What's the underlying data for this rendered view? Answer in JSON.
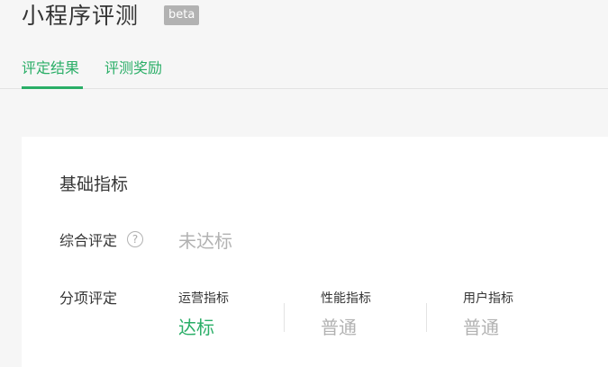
{
  "header": {
    "title": "小程序评测",
    "badge": "beta",
    "tabs": [
      {
        "label": "评定结果",
        "active": true
      },
      {
        "label": "评测奖励",
        "active": false
      }
    ]
  },
  "basic_metrics": {
    "section_title": "基础指标",
    "overall": {
      "label": "综合评定",
      "help_icon": "question-circle-icon",
      "value": "未达标"
    },
    "items": {
      "label": "分项评定",
      "metrics": [
        {
          "name": "运营指标",
          "value": "达标"
        },
        {
          "name": "性能指标",
          "value": "普通"
        },
        {
          "name": "用户指标",
          "value": "普通"
        }
      ]
    }
  },
  "colors": {
    "accent_green": "#2aae67",
    "muted_gray": "#b2b2b2",
    "text_dark": "#353535",
    "background": "#f6f6f6"
  }
}
